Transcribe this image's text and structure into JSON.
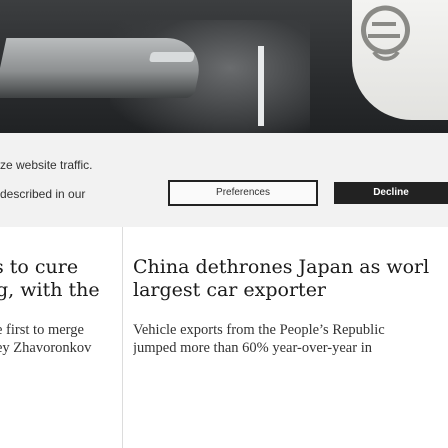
{
  "consent": {
    "line1": "ze website traffic.",
    "line2": "described in our",
    "preferences_label": "Preferences",
    "decline_label": "Decline"
  },
  "left_story": {
    "headline_line1": "s to cure",
    "headline_line2": "g, with the",
    "body_line1": "e first to merge",
    "body_line2": "ey Zhavoronkov"
  },
  "main_story": {
    "headline_line1": "China dethrones Japan as worl",
    "headline_line2": "largest car exporter",
    "body_line1": "Vehicle exports from the People’s Republic",
    "body_line2": "jumped more than 60% year-over-year in"
  },
  "icons": {
    "hero_emblem": "brand-emblem-icon"
  }
}
